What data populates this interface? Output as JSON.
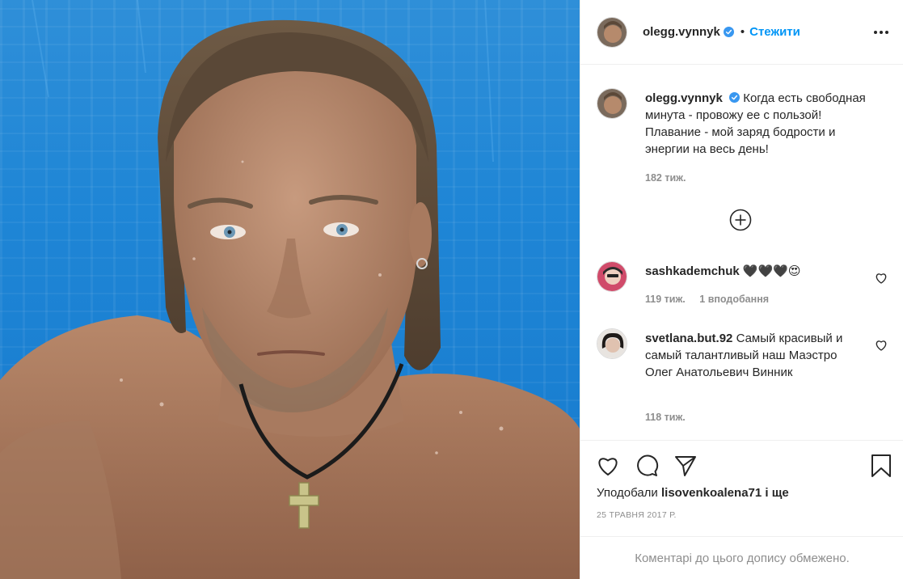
{
  "post": {
    "author": "olegg.vynnyk",
    "follow_label": "Стежити",
    "dot": "•",
    "caption": "Когда есть свободная минута - провожу ее с пользой! Плавание - мой заряд бодрости и энергии на весь день!",
    "caption_time": "182 тиж.",
    "date": "25 ТРАВНЯ 2017 Р.",
    "comments_disabled": "Коментарі до цього допису обмежено."
  },
  "likes": {
    "prefix": "Уподобали",
    "user": "lisovenkoalena71",
    "suffix": "і ще"
  },
  "comments": [
    {
      "user": "sashkademchuk",
      "text": "🖤🖤🖤😍",
      "time": "119 тиж.",
      "likes": "1 вподобання"
    },
    {
      "user": "svetlana.but.92",
      "text": "Самый красивый и самый талантливый наш Маэстро Олег Анатольевич Винник",
      "time": "118 тиж."
    }
  ],
  "icons": {
    "verified": "verified-badge-icon",
    "more": "more-options-icon",
    "add": "load-more-comments-icon",
    "heart": "heart-icon",
    "comment": "comment-icon",
    "share": "share-icon",
    "save": "bookmark-icon"
  },
  "colors": {
    "accent": "#0095f6",
    "muted": "#8e8e8e",
    "text": "#262626",
    "pool": "#1f86d6"
  }
}
